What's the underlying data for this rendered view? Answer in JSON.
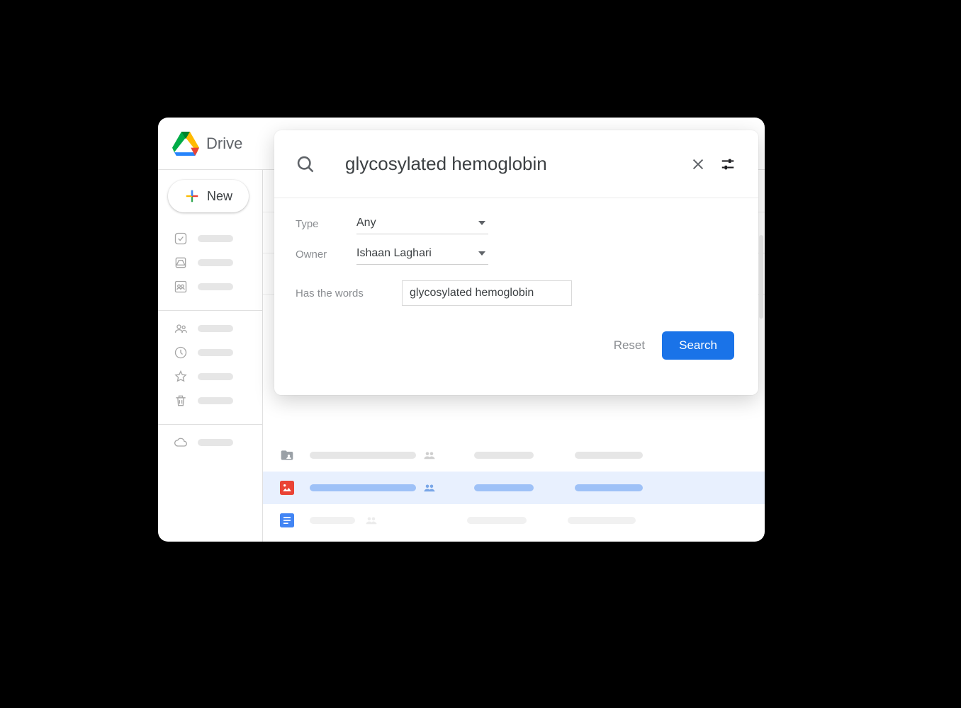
{
  "app": {
    "title": "Drive",
    "new_button": "New"
  },
  "search_panel": {
    "query": "glycosylated hemoglobin",
    "filters": {
      "type_label": "Type",
      "type_value": "Any",
      "owner_label": "Owner",
      "owner_value": "Ishaan Laghari",
      "words_label": "Has the words",
      "words_value": "glycosylated hemoglobin"
    },
    "reset_label": "Reset",
    "search_label": "Search"
  }
}
